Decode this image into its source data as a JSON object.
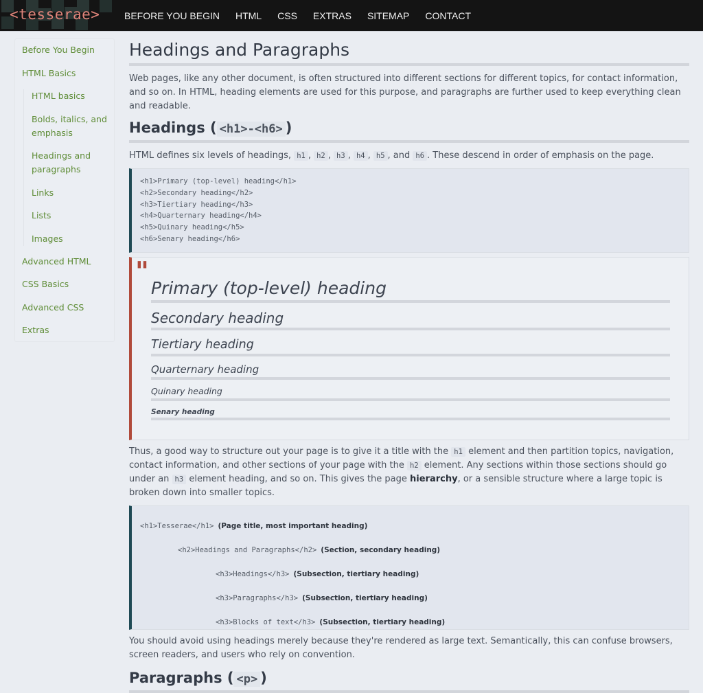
{
  "header": {
    "logo": "<tesserae>",
    "nav": [
      "BEFORE YOU BEGIN",
      "HTML",
      "CSS",
      "EXTRAS",
      "SITEMAP",
      "CONTACT"
    ]
  },
  "sidebar": {
    "items_top": [
      "Before You Begin",
      "HTML Basics"
    ],
    "sub_items": [
      "HTML basics",
      "Bolds, italics, and emphasis",
      "Headings and paragraphs",
      "Links",
      "Lists",
      "Images"
    ],
    "items_bottom": [
      "Advanced HTML",
      "CSS Basics",
      "Advanced CSS",
      "Extras"
    ]
  },
  "main": {
    "title": "Headings and Paragraphs",
    "intro": "Web pages, like any other document, is often structured into different sections for different topics, for contact information, and so on. In HTML, heading elements are used for this purpose, and paragraphs are further used to keep everything clean and readable.",
    "headings_section": {
      "title": "Headings (",
      "title_code": "<h1>-<h6>",
      "title_end": ")",
      "desc_before": "HTML defines six levels of headings, ",
      "codes": [
        "h1",
        "h2",
        "h3",
        "h4",
        "h5",
        "h6"
      ],
      "sep": ", ",
      "and": ", and ",
      "desc_after": ". These descend in order of emphasis on the page.",
      "code_lines": [
        "<h1>Primary (top-level) heading</h1>",
        "<h2>Secondary heading</h2>",
        "<h3>Tiertiary heading</h3>",
        "<h4>Quarternary heading</h4>",
        "<h5>Quinary heading</h5>",
        "<h6>Senary heading</h6>"
      ],
      "demo_quote_mark": "\"",
      "demo_headings": [
        "Primary (top-level) heading",
        "Secondary heading",
        "Tiertiary heading",
        "Quarternary heading",
        "Quinary heading",
        "Senary heading"
      ]
    },
    "hierarchy_para": {
      "t1": "Thus, a good way to structure out your page is to give it a title with the ",
      "c1": "h1",
      "t2": " element and then partition topics, navigation, contact information, and other sections of your page with the ",
      "c2": "h2",
      "t3": " element. Any sections within those sections should go under an ",
      "c3": "h3",
      "t4": " element heading, and so on. This gives the page ",
      "bold": "hierarchy",
      "t5": ", or a sensible structure where a large topic is broken down into smaller topics."
    },
    "tree": [
      {
        "code": "<h1>Tesserae</h1>",
        "note": "(Page title, most important heading)"
      },
      {
        "code": "<h2>Headings and Paragraphs</h2>",
        "note": "(Section, secondary heading)"
      },
      {
        "code": "<h3>Headings</h3>",
        "note": "(Subsection, tiertiary heading)"
      },
      {
        "code": "<h3>Paragraphs</h3>",
        "note": "(Subsection, tiertiary heading)"
      },
      {
        "code": "<h3>Blocks of text</h3>",
        "note": "(Subsection, tiertiary heading)"
      }
    ],
    "avoid_para": "You should avoid using headings merely because they're rendered as large text. Semantically, this can confuse browsers, screen readers, and users who rely on convention.",
    "paragraphs_section": {
      "title": "Paragraphs (",
      "title_code": "<p>",
      "title_end": ")"
    }
  },
  "colors": {
    "accent_link": "#5e8c36",
    "logo": "#e0847a",
    "quote_border": "#b04a3a",
    "code_border": "#1f4a55"
  }
}
